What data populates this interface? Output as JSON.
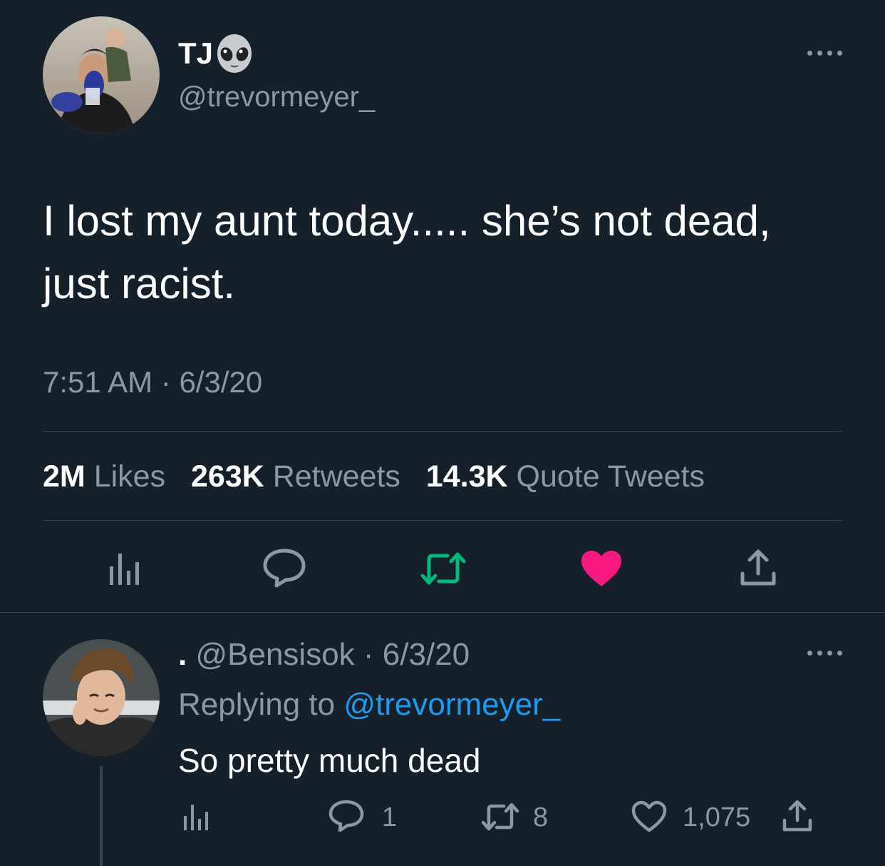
{
  "tweet": {
    "display_name": "TJ",
    "name_emoji": "alien-emoji",
    "handle": "@trevormeyer_",
    "text": "I lost my aunt today..... she’s not dead, just racist.",
    "time": "7:51 AM",
    "separator": "·",
    "date": "6/3/20",
    "stats": {
      "likes_count": "2M",
      "likes_label": "Likes",
      "retweets_count": "263K",
      "retweets_label": "Retweets",
      "quotes_count": "14.3K",
      "quotes_label": "Quote Tweets"
    },
    "actions": [
      "analytics-icon",
      "reply-icon",
      "retweet-icon",
      "like-icon-filled",
      "share-icon"
    ]
  },
  "reply": {
    "display_name": ".",
    "handle": "@Bensisok",
    "separator": "·",
    "date": "6/3/20",
    "replying_prefix": "Replying to",
    "replying_to": "@trevormeyer_",
    "text": "So pretty much dead",
    "reply_count": "1",
    "retweet_count": "8",
    "like_count": "1,075"
  },
  "colors": {
    "background": "#15202b",
    "text": "#ffffff",
    "muted": "#8b98a5",
    "link": "#1d9bf0",
    "retweet_active": "#00ba7c",
    "like_active": "#f91880",
    "divider": "#38444d"
  }
}
